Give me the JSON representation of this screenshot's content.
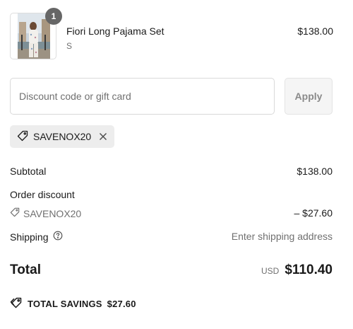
{
  "product": {
    "quantity": "1",
    "name": "Fiori Long Pajama Set",
    "variant": "S",
    "price": "$138.00",
    "image_icon": "product-photo"
  },
  "discount": {
    "placeholder": "Discount code or gift card",
    "value": "",
    "apply_label": "Apply",
    "applied_code": "SAVENOX20",
    "tag_icon": "tag-icon",
    "remove_icon": "close-icon"
  },
  "summary": {
    "subtotal_label": "Subtotal",
    "subtotal_value": "$138.00",
    "order_discount_label": "Order discount",
    "discount_code": "SAVENOX20",
    "discount_value": "– $27.60",
    "shipping_label": "Shipping",
    "shipping_value": "Enter shipping address",
    "total_label": "Total",
    "currency": "USD",
    "total_value": "$110.40"
  },
  "savings": {
    "label": "TOTAL SAVINGS",
    "value": "$27.60"
  },
  "colors": {
    "text": "#1a1a1a",
    "muted": "#707070",
    "border": "#d9d9d9",
    "chip_bg": "#ededed",
    "badge_bg": "#666666"
  }
}
